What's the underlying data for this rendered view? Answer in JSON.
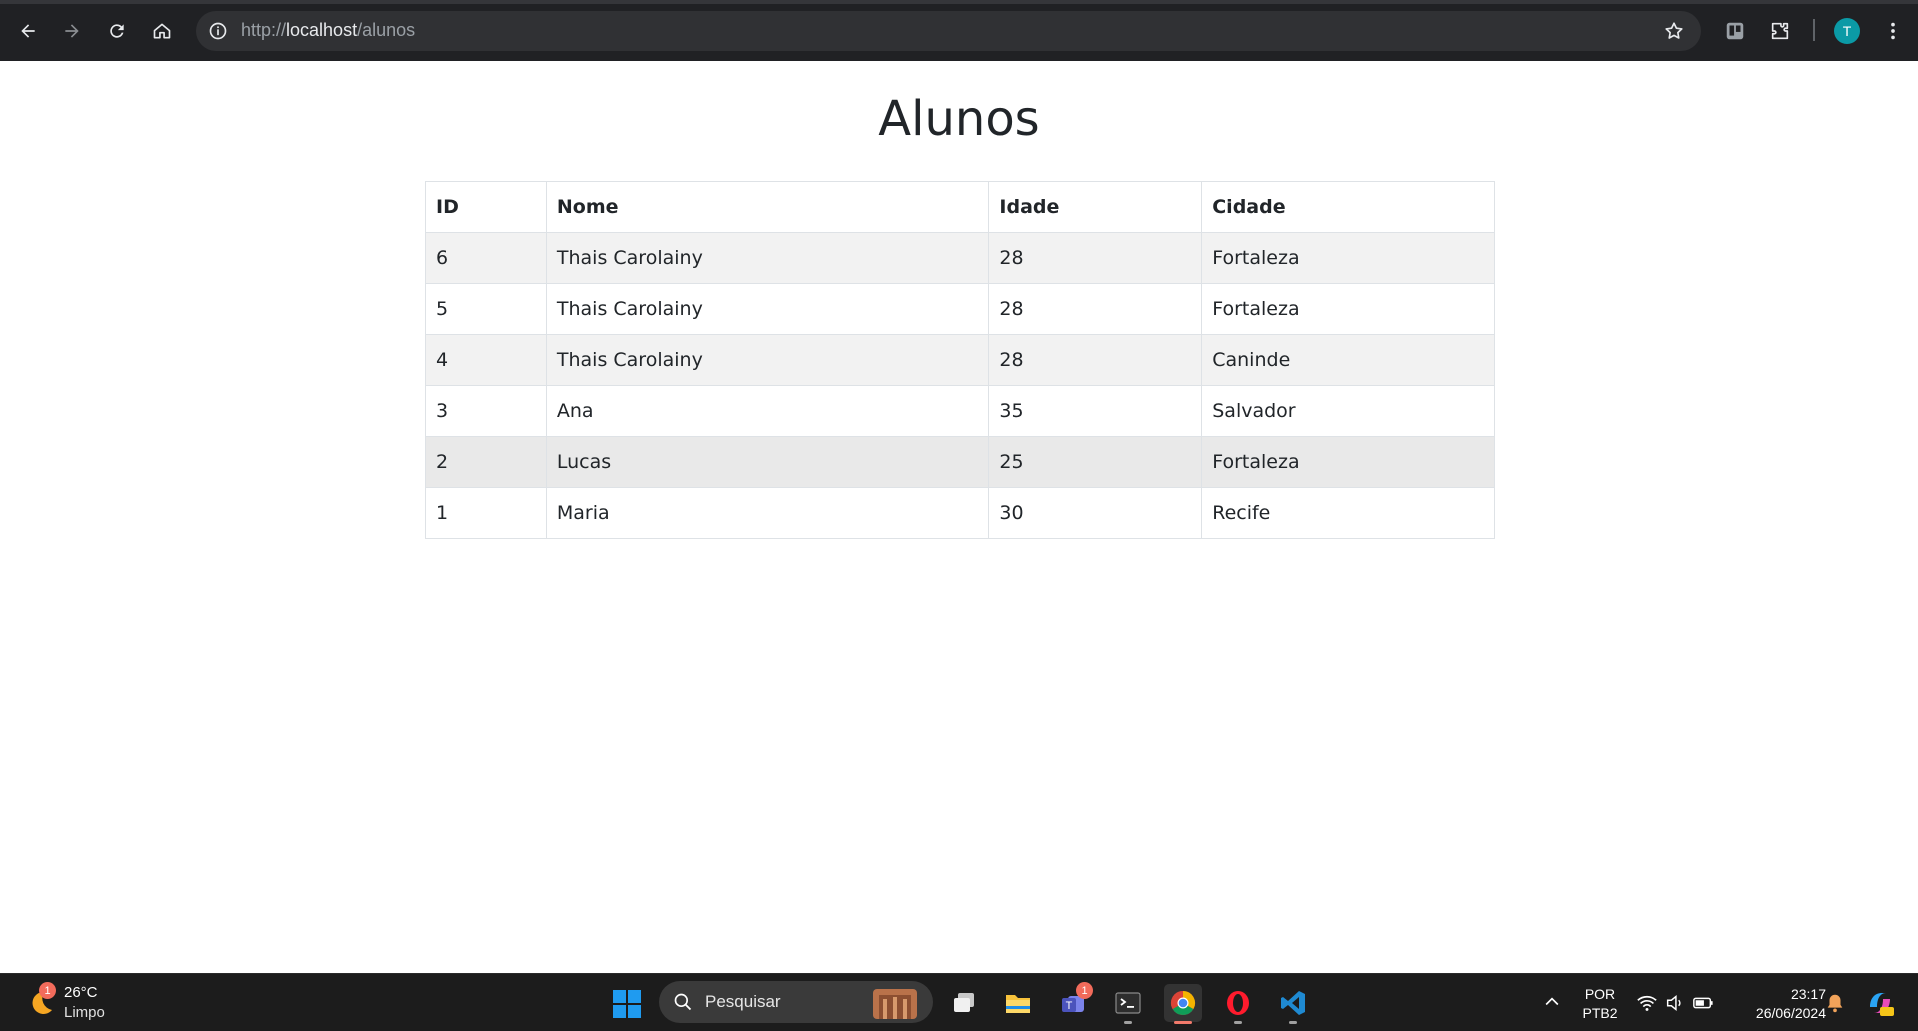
{
  "browser": {
    "url_prefix": "http://",
    "url_host": "localhost",
    "url_path": "/alunos",
    "profile_initial": "T"
  },
  "page": {
    "title": "Alunos",
    "table": {
      "headers": [
        "ID",
        "Nome",
        "Idade",
        "Cidade"
      ],
      "rows": [
        [
          "6",
          "Thais Carolainy",
          "28",
          "Fortaleza"
        ],
        [
          "5",
          "Thais Carolainy",
          "28",
          "Fortaleza"
        ],
        [
          "4",
          "Thais Carolainy",
          "28",
          "Caninde"
        ],
        [
          "3",
          "Ana",
          "35",
          "Salvador"
        ],
        [
          "2",
          "Lucas",
          "25",
          "Fortaleza"
        ],
        [
          "1",
          "Maria",
          "30",
          "Recife"
        ]
      ]
    }
  },
  "taskbar": {
    "weather_temp": "26°C",
    "weather_desc": "Limpo",
    "weather_badge": "1",
    "search_placeholder": "Pesquisar",
    "teams_badge": "1",
    "lang_line1": "POR",
    "lang_line2": "PTB2",
    "time": "23:17",
    "date": "26/06/2024"
  }
}
